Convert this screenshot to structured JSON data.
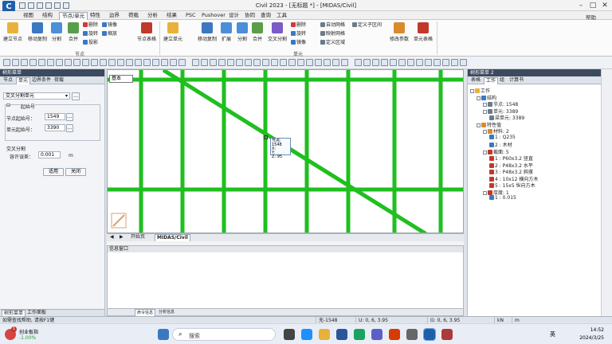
{
  "window": {
    "title": "Civil 2023 - [无标题 *] - [MIDAS/Civil]",
    "logo": "C"
  },
  "menu": {
    "tabs": [
      "视图",
      "结构",
      "节点/单元",
      "特性",
      "边界",
      "荷载",
      "分析",
      "结果",
      "PSC",
      "Pushover",
      "设计",
      "协同",
      "查询",
      "工具"
    ],
    "active_index": 2,
    "help": "帮助"
  },
  "ribbon": {
    "node_group": {
      "label": "节点",
      "buttons": [
        "建立节点",
        "移动复制",
        "分割",
        "合并"
      ],
      "small": [
        "删除",
        "旋转",
        "投影",
        "镜像",
        "缩放"
      ],
      "extra": "节点表格"
    },
    "element_group": {
      "label": "单元",
      "buttons": [
        "建立单元",
        "移动复制",
        "扩展",
        "分割",
        "合并",
        "交叉分割"
      ],
      "small": [
        "删除",
        "旋转",
        "镜像"
      ],
      "grid": [
        "自动网格",
        "映射网格",
        "定义区域",
        "定义子区间"
      ],
      "extra1": "修改参数",
      "extra2": "单元表格"
    }
  },
  "left_panel": {
    "title": "树形菜单",
    "tabs": [
      "节点",
      "单元",
      "边界条件",
      "荷载"
    ],
    "active_tab": 1,
    "function_select": "交叉分割单元",
    "start_number_label": "起始号",
    "node_start_label": "节点起始号：",
    "node_start_value": "1549",
    "elem_start_label": "单元起始号：",
    "elem_start_value": "3390",
    "intersect_label": "交叉分割",
    "tolerance_label": "容许误差：",
    "tolerance_value": "0.001",
    "tolerance_unit": "m",
    "apply": "适用",
    "close": "关闭",
    "bottom_tabs": [
      "树形菜单",
      "工作面板"
    ]
  },
  "canvas": {
    "view_label": "基本",
    "tooltip_lines": [
      "节点: 1548",
      "X: ",
      "Y: ",
      "Z: 95"
    ],
    "doc_tabs": [
      "开始页",
      "MIDAS/Civil"
    ]
  },
  "message": {
    "title": "信息窗口",
    "bottom_tabs": [
      "命令信息",
      "分析信息"
    ]
  },
  "right_panel": {
    "title": "树形菜单 2",
    "tabs": [
      "表格",
      "工作",
      "组",
      "计算书"
    ],
    "active_tab": 1,
    "tree": [
      {
        "t": "工作",
        "lvl": 0,
        "icon": "folder-icon"
      },
      {
        "t": "结构",
        "lvl": 1,
        "icon": "structure-icon"
      },
      {
        "t": "节点: 1548",
        "lvl": 2,
        "icon": "node-icon"
      },
      {
        "t": "单元: 3389",
        "lvl": 2,
        "icon": "element-icon"
      },
      {
        "t": "梁单元: 3389",
        "lvl": 3,
        "icon": "beam-icon"
      },
      {
        "t": "特性值",
        "lvl": 1,
        "icon": "property-icon"
      },
      {
        "t": "材料: 2",
        "lvl": 2,
        "icon": "material-icon"
      },
      {
        "t": "1 : Q235",
        "lvl": 3,
        "icon": "item-icon"
      },
      {
        "t": "2 : 木材",
        "lvl": 3,
        "icon": "item-icon"
      },
      {
        "t": "截面: 5",
        "lvl": 2,
        "icon": "section-icon"
      },
      {
        "t": "1 : P60x3.2 竖直",
        "lvl": 3,
        "icon": "ibeam-icon"
      },
      {
        "t": "2 : P48x3.2 水平",
        "lvl": 3,
        "icon": "ibeam-icon"
      },
      {
        "t": "3 : P48x3.2 斜撑",
        "lvl": 3,
        "icon": "ibeam-icon"
      },
      {
        "t": "4 : 10x12 横向方木",
        "lvl": 3,
        "icon": "ibeam-icon"
      },
      {
        "t": "5 : 15x5 纵向方木",
        "lvl": 3,
        "icon": "ibeam-icon"
      },
      {
        "t": "厚度: 1",
        "lvl": 2,
        "icon": "thickness-icon"
      },
      {
        "t": "1 : 0.015",
        "lvl": 3,
        "icon": "item-icon"
      }
    ]
  },
  "status": {
    "hint": "如需查找帮助, 请按F1键",
    "fields": [
      "无-1548",
      "U: 0, 6, 3.95",
      "G: 0, 6, 3.95"
    ],
    "unit": "kN",
    "unit2": "m"
  },
  "taskbar": {
    "stock_name": "创业板指",
    "stock_change": "-1.00%",
    "stock_badge": "1",
    "search": "搜索",
    "lang": "英",
    "time": "14:52",
    "date": "2024/3/25"
  },
  "colors": {
    "member": "#1fbf1f",
    "ribbon_bg": "#fbfbfb",
    "accent": "#1f5fa8"
  }
}
